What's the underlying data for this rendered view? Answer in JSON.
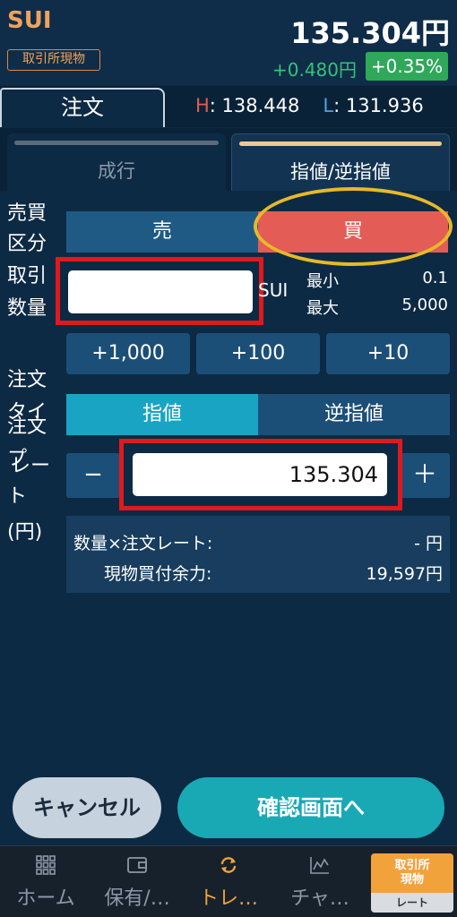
{
  "header": {
    "symbol": "SUI",
    "market_badge": "取引所現物",
    "price": "135.304円",
    "change": "+0.480円",
    "change_pct": "+0.35%"
  },
  "order_tab": {
    "label": "注文",
    "high_label": "H",
    "high_value": ": 138.448",
    "low_label": "L",
    "low_value": ": 131.936"
  },
  "sub_tabs": [
    {
      "label": "成行"
    },
    {
      "label": "指値/逆指値"
    }
  ],
  "side": {
    "label_line1": "売買",
    "label_line2": "区分",
    "sell": "売",
    "buy": "買"
  },
  "quantity": {
    "label_line1": "取引",
    "label_line2": "数量",
    "value": "",
    "unit": "SUI",
    "min_label": "最小",
    "min_value": "0.1",
    "max_label": "最大",
    "max_value": "5,000",
    "increments": [
      "+1,000",
      "+100",
      "+10"
    ]
  },
  "order_rate": {
    "label_lines": [
      "注文",
      "タイ",
      "注文",
      "プ",
      "レー",
      "ト",
      "(円)"
    ],
    "type_limit": "指値",
    "type_stop": "逆指値",
    "minus": "−",
    "plus": "＋",
    "value": "135.304"
  },
  "summary": {
    "qty_rate_label": "数量×注文レート:",
    "qty_rate_value": "- 円",
    "available_label": "現物買付余力:",
    "available_value": "19,597円"
  },
  "actions": {
    "cancel": "キャンセル",
    "confirm": "確認画面へ"
  },
  "nav": {
    "items": [
      {
        "label": "ホーム",
        "icon": "grid-icon"
      },
      {
        "label": "保有/…",
        "icon": "wallet-icon"
      },
      {
        "label": "トレ…",
        "icon": "refresh-icon"
      },
      {
        "label": "チャ…",
        "icon": "chart-icon"
      }
    ],
    "rate_button_line1": "取引所",
    "rate_button_line2": "現物",
    "rate_button_line3": "レート"
  },
  "colors": {
    "accent_orange": "#f2a23a",
    "buy_red": "#e35c55",
    "limit_teal": "#1aa4c4",
    "confirm_teal": "#18a9b5",
    "positive_green": "#2fa85a"
  }
}
